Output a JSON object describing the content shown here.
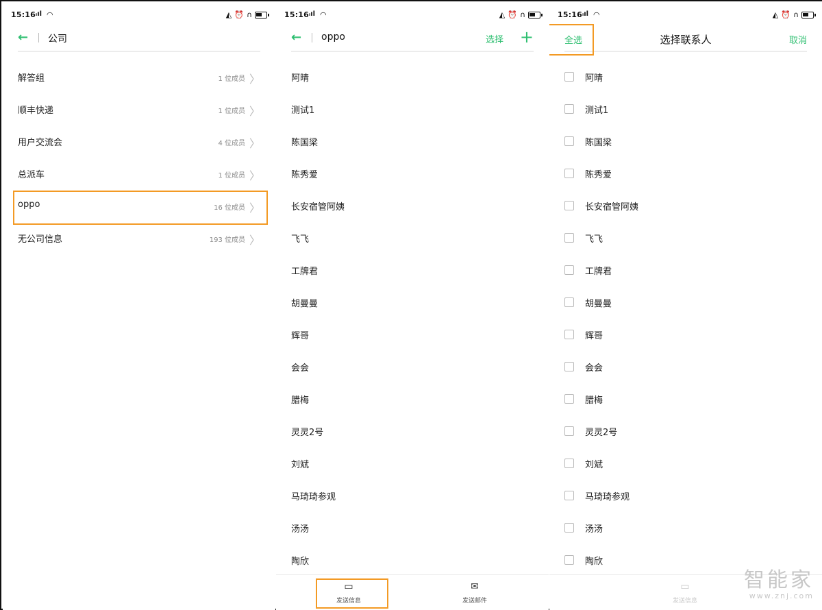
{
  "status_bar": {
    "time": "15:16",
    "signal": "𝔰ıl"
  },
  "colors": {
    "accent": "#2fbf71",
    "highlight": "#f39a24"
  },
  "panel1": {
    "title": "公司",
    "groups": [
      {
        "name": "解答组",
        "count": "1 位成员"
      },
      {
        "name": "顺丰快递",
        "count": "1 位成员"
      },
      {
        "name": "用户交流会",
        "count": "4 位成员"
      },
      {
        "name": "总派车",
        "count": "1 位成员"
      },
      {
        "name": "oppo",
        "count": "16 位成员"
      },
      {
        "name": "无公司信息",
        "count": "193 位成员"
      }
    ]
  },
  "panel2": {
    "title": "oppo",
    "select_label": "选择",
    "add_label": "+",
    "contacts": [
      "阿晴",
      "测试1",
      "陈国梁",
      "陈秀爱",
      "长安宿管阿姨",
      "飞飞",
      "工牌君",
      "胡曼曼",
      "辉哥",
      "会会",
      "腊梅",
      "灵灵2号",
      "刘斌",
      "马琦琦参观",
      "汤汤",
      "陶欣"
    ],
    "bottom_tabs": [
      {
        "label": "发送信息",
        "icon": "message-icon"
      },
      {
        "label": "发送邮件",
        "icon": "mail-icon"
      }
    ]
  },
  "panel3": {
    "title": "选择联系人",
    "select_all_label": "全选",
    "cancel_label": "取消",
    "contacts": [
      "阿晴",
      "测试1",
      "陈国梁",
      "陈秀爱",
      "长安宿管阿姨",
      "飞飞",
      "工牌君",
      "胡曼曼",
      "辉哥",
      "会会",
      "腊梅",
      "灵灵2号",
      "刘斌",
      "马琦琦参观",
      "汤汤",
      "陶欣"
    ],
    "bottom_tab": {
      "label": "发送信息",
      "icon": "message-icon"
    }
  },
  "watermark": {
    "line1": "智能家",
    "line2": "www.znj.com"
  }
}
